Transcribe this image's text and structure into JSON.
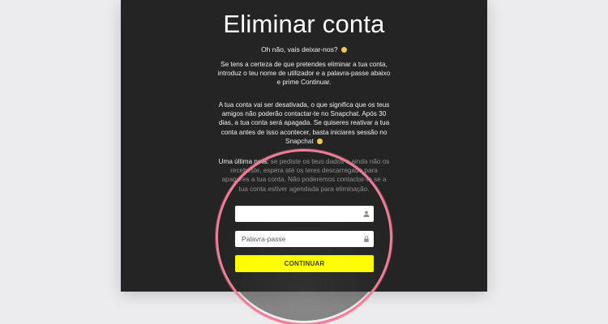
{
  "page": {
    "title": "Eliminar conta",
    "subtitle": "Oh não, vais deixar-nos?",
    "paragraph1": "Se tens a certeza de que pretendes eliminar a tua conta, introduz o teu nome de utilizador e a palavra-passe abaixo e prime Continuar.",
    "paragraph2": "A tua conta vai ser desativada, o que significa que os teus amigos não poderão contactar-te no Snapchat. Após 30 dias, a tua conta será apagada. Se quiseres reativar a tua conta antes de isso acontecer, basta iniciares sessão no Snapchat",
    "paragraph3_lead": "Uma última nota:",
    "paragraph3_rest": " se pediste os teus dados e ainda não os recebeste, espera até os teres descarregado para apagares a tua conta. Não poderemos contactar-te se a tua conta estiver agendada para eliminação."
  },
  "form": {
    "username_value": "",
    "username_placeholder": "",
    "password_placeholder": "Palavra-passe",
    "continue_label": "CONTINUAR"
  },
  "icons": {
    "subtitle_emoji": "smiley-icon",
    "paragraph2_emoji": "smiley-icon",
    "username_icon": "user-icon",
    "password_icon": "lock-icon"
  },
  "colors": {
    "panel_bg": "#242424",
    "button_bg": "#fffc00",
    "lens_ring": "#f07d95",
    "page_bg": "#ececef"
  }
}
